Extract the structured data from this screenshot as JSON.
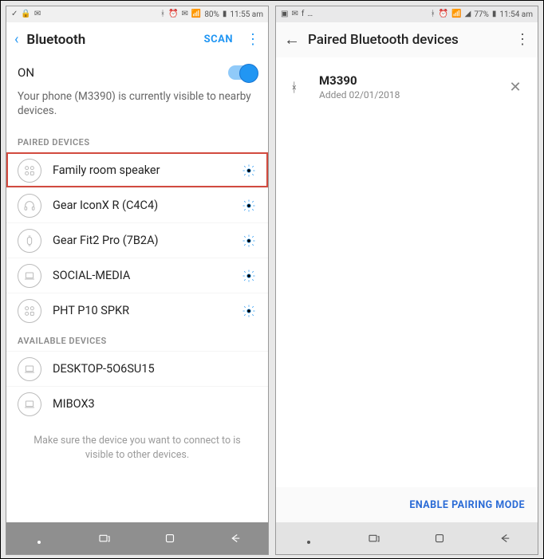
{
  "left": {
    "statusbar": {
      "left_icons": [
        "✓",
        "🔒",
        "✉"
      ],
      "right_icons": [
        "ᚼ",
        "⏰",
        "✉",
        "📶"
      ],
      "battery": "80%",
      "time": "11:55 am"
    },
    "header": {
      "title": "Bluetooth",
      "scan": "SCAN"
    },
    "toggle_label": "ON",
    "visibility_text": "Your phone (M3390) is currently visible to nearby devices.",
    "paired_label": "PAIRED DEVICES",
    "paired": [
      {
        "name": "Family room speaker",
        "icon": "grid",
        "gear": true,
        "highlight": true
      },
      {
        "name": "Gear IconX R (C4C4)",
        "icon": "headphone",
        "gear": true
      },
      {
        "name": "Gear Fit2 Pro (7B2A)",
        "icon": "watch",
        "gear": true
      },
      {
        "name": "SOCIAL-MEDIA",
        "icon": "laptop",
        "gear": true
      },
      {
        "name": "PHT P10 SPKR",
        "icon": "grid",
        "gear": true
      }
    ],
    "available_label": "AVAILABLE DEVICES",
    "available": [
      {
        "name": "DESKTOP-5O6SU15",
        "icon": "laptop"
      },
      {
        "name": "MIBOX3",
        "icon": "laptop"
      }
    ],
    "hint": "Make sure the device you want to connect to is visible to other devices."
  },
  "right": {
    "statusbar": {
      "left_icons": [
        "▣",
        "✉",
        "f",
        "…"
      ],
      "right_icons": [
        "ᚼ",
        "⏰",
        "📶",
        "◢"
      ],
      "battery": "77%",
      "time": "11:54 am"
    },
    "header": {
      "title": "Paired Bluetooth devices"
    },
    "item": {
      "name": "M3390",
      "sub": "Added 02/01/2018"
    },
    "footer": "ENABLE PAIRING MODE"
  }
}
